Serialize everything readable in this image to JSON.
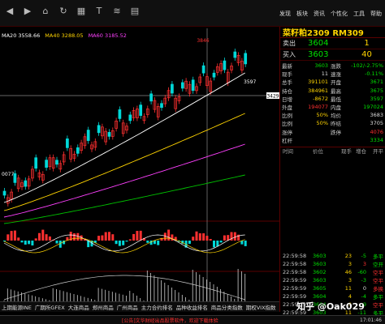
{
  "toolbar": {
    "icons": [
      "back-icon",
      "forward-icon",
      "home-icon",
      "refresh-icon",
      "grid-icon",
      "text-icon",
      "chart-icon",
      "document-icon"
    ],
    "menu": [
      "发现",
      "板块",
      "资讯",
      "个性化",
      "工具",
      "帮助"
    ]
  },
  "ma": {
    "ma20": "MA20 3558.66",
    "ma40": "MA40 3288.05",
    "ma60": "MA60 3185.52"
  },
  "chart_labels": {
    "high_marker": "3846",
    "low_marker": "3597",
    "price_line": "3429",
    "left_low": "0077",
    "date_mid": "2023/07/03",
    "date_cursor": "2023/07/20 星期四",
    "date_left": "21",
    "date_right": "8"
  },
  "panel": {
    "title": "菜籽粕2309  RM309",
    "sell": {
      "label": "卖出",
      "price": "3604",
      "vol": "1"
    },
    "buy": {
      "label": "买入",
      "price": "3603",
      "vol": "40"
    },
    "stats": [
      {
        "k1": "最新",
        "v1": "3603",
        "c1": "c-green",
        "k2": "涨跌",
        "v2": "-102/-2.75%",
        "c2": "c-green"
      },
      {
        "k1": "现手",
        "v1": "11",
        "c1": "c-white",
        "k2": "速涨",
        "v2": "-0.11%",
        "c2": "c-green"
      },
      {
        "k1": "总手",
        "v1": "391101",
        "c1": "c-yellow",
        "k2": "开盘",
        "v2": "3671",
        "c2": "c-green"
      },
      {
        "k1": "持仓",
        "v1": "384961",
        "c1": "c-yellow",
        "k2": "最高",
        "v2": "3675",
        "c2": "c-green"
      },
      {
        "k1": "日增",
        "v1": "-8672",
        "c1": "c-yellow",
        "k2": "最低",
        "v2": "3597",
        "c2": "c-green"
      },
      {
        "k1": "外盘",
        "v1": "194077",
        "c1": "c-red",
        "k2": "内盘",
        "v2": "197024",
        "c2": "c-green"
      },
      {
        "k1": "比例",
        "v1": "50%",
        "c1": "c-yellow",
        "k2": "均价",
        "v2": "3683",
        "c2": "c-white"
      },
      {
        "k1": "比例",
        "v1": "50%",
        "c1": "c-yellow",
        "k2": "昨结",
        "v2": "3705",
        "c2": "c-white"
      },
      {
        "k1": "涨停",
        "v1": "",
        "c1": "c-white",
        "k2": "跌停",
        "v2": "4076",
        "c2": "c-red"
      },
      {
        "k1": "杠杆",
        "v1": "",
        "c1": "c-white",
        "k2": "",
        "v2": "3334",
        "c2": "c-green"
      }
    ],
    "ticks_head": [
      "时间",
      "价位",
      "现手",
      "增仓",
      "开平"
    ],
    "ticks": [
      {
        "time": "22:59:58",
        "price": "3603",
        "qty": "23",
        "chg": "-5",
        "type": "多平",
        "cc": "c-green",
        "tc": "c-green"
      },
      {
        "time": "22:59:58",
        "price": "3603",
        "qty": "3",
        "chg": "3",
        "type": "空开",
        "cc": "c-red",
        "tc": "c-green"
      },
      {
        "time": "22:59:58",
        "price": "3602",
        "qty": "46",
        "chg": "-60",
        "type": "空平",
        "cc": "c-green",
        "tc": "c-red"
      },
      {
        "time": "22:59:59",
        "price": "3603",
        "qty": "3",
        "chg": "-3",
        "type": "空平",
        "cc": "c-green",
        "tc": "c-red"
      },
      {
        "time": "22:59:59",
        "price": "3605",
        "qty": "11",
        "chg": "0",
        "type": "多换",
        "cc": "c-white",
        "tc": "c-red"
      },
      {
        "time": "22:59:59",
        "price": "3604",
        "qty": "4",
        "chg": "-4",
        "type": "多平",
        "cc": "c-green",
        "tc": "c-green"
      },
      {
        "time": "22:59:59",
        "price": "3604",
        "qty": "9",
        "chg": "-9",
        "type": "空平",
        "cc": "c-green",
        "tc": "c-red"
      },
      {
        "time": "22:59:59",
        "price": "3603",
        "qty": "11",
        "chg": "-11",
        "type": "多平",
        "cc": "c-green",
        "tc": "c-green"
      }
    ]
  },
  "bottom_tabs": [
    "上期能源INE",
    "广期所GFEX",
    "大连商品",
    "郑州商品",
    "广州商品",
    "主力合约排名",
    "品种收益排名",
    "商品分类指数",
    "期权VIX指数"
  ],
  "status": {
    "notice": "[公告]文华财经出品股票软件，欢迎下载体验",
    "clock": "17:01:46"
  },
  "watermark": "知乎 @Oak029"
}
